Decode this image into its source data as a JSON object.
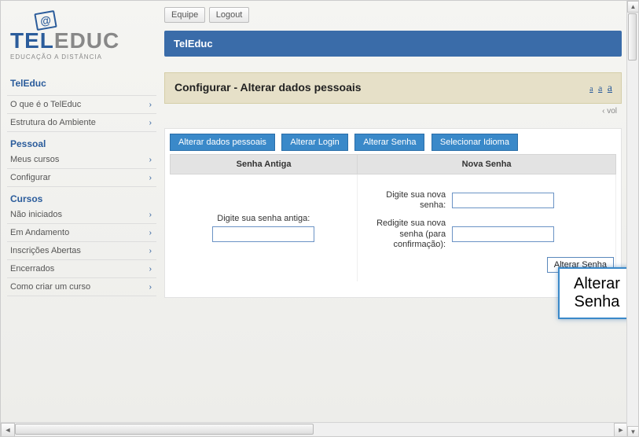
{
  "logo": {
    "at": "@",
    "tel": "TEL",
    "educ": "EDUC",
    "sub": "EDUCAÇÃO A DISTÂNCIA"
  },
  "topbar": {
    "equipe": "Equipe",
    "logout": "Logout"
  },
  "bluebar": {
    "title": "TelEduc"
  },
  "section": {
    "title": "Configurar - Alterar dados pessoais",
    "vol": "‹ vol"
  },
  "fontsizer": {
    "s1": "a",
    "s2": "a",
    "s3": "a"
  },
  "nav": {
    "teleduc": "TelEduc",
    "group1": [
      {
        "label": "O que é o TelEduc"
      },
      {
        "label": "Estrutura do Ambiente"
      }
    ],
    "h_pessoal": "Pessoal",
    "group2": [
      {
        "label": "Meus cursos"
      },
      {
        "label": "Configurar"
      }
    ],
    "h_cursos": "Cursos",
    "group3": [
      {
        "label": "Não iniciados"
      },
      {
        "label": "Em Andamento"
      },
      {
        "label": "Inscrições Abertas"
      },
      {
        "label": "Encerrados"
      },
      {
        "label": "Como criar um curso"
      }
    ]
  },
  "tabs": {
    "t1": "Alterar dados pessoais",
    "t2": "Alterar Login",
    "t3": "Alterar Senha",
    "t4": "Selecionar Idioma"
  },
  "table": {
    "col1": "Senha Antiga",
    "col2": "Nova Senha"
  },
  "form": {
    "old_label": "Digite sua senha antiga:",
    "new_label": "Digite sua nova senha:",
    "confirm_label": "Redigite sua nova senha (para confirmação):",
    "submit": "Alterar Senha"
  },
  "callout": {
    "label": "Alterar Senha"
  }
}
